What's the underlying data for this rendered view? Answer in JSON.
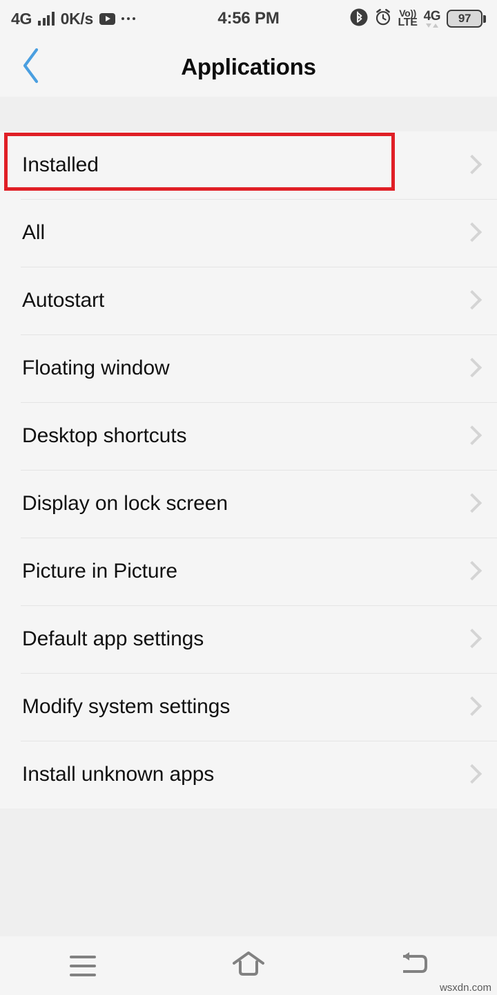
{
  "status_bar": {
    "network_type": "4G",
    "data_rate": "0K/s",
    "time": "4:56 PM",
    "volte_top": "Vo))",
    "volte_bottom": "LTE",
    "network_right": "4G",
    "battery_level": "97",
    "icons": [
      "signal-bars-icon",
      "youtube-icon",
      "overflow-dots-icon",
      "bluetooth-icon",
      "alarm-icon",
      "volte-icon",
      "battery-icon"
    ]
  },
  "header": {
    "title": "Applications",
    "back_icon": "chevron-left-icon",
    "back_color": "#4a9fe0"
  },
  "list": {
    "items": [
      {
        "label": "Installed",
        "highlighted": true
      },
      {
        "label": "All",
        "highlighted": false
      },
      {
        "label": "Autostart",
        "highlighted": false
      },
      {
        "label": "Floating window",
        "highlighted": false
      },
      {
        "label": "Desktop shortcuts",
        "highlighted": false
      },
      {
        "label": "Display on lock screen",
        "highlighted": false
      },
      {
        "label": "Picture in Picture",
        "highlighted": false
      },
      {
        "label": "Default app settings",
        "highlighted": false
      },
      {
        "label": "Modify system settings",
        "highlighted": false
      },
      {
        "label": "Install unknown apps",
        "highlighted": false
      }
    ],
    "chevron_icon": "chevron-right-icon",
    "annotation_color": "#e01f26"
  },
  "navbar": {
    "menu_icon": "menu-icon",
    "home_icon": "home-icon",
    "back_icon": "back-icon"
  },
  "watermark": {
    "text": "wsxdn.com"
  },
  "colors": {
    "page_bg": "#f5f5f5",
    "band_bg": "#efefef",
    "divider": "#e4e4e4",
    "text_primary": "#111111",
    "chevron": "#d4d4d4",
    "nav_icon": "#818181"
  }
}
